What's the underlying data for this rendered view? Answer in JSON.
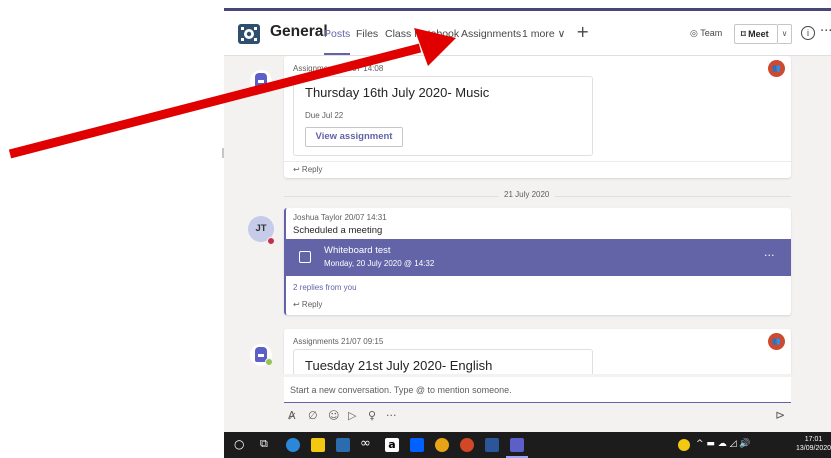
{
  "channel": {
    "name": "General",
    "icon": "team-icon"
  },
  "tabs": [
    {
      "label": "Posts",
      "active": true
    },
    {
      "label": "Files"
    },
    {
      "label": "Class Notebook"
    },
    {
      "label": "Assignments"
    },
    {
      "label": "1 more ∨"
    }
  ],
  "header": {
    "add_icon": "+",
    "team_label": "◎ Team",
    "meet_label": "Meet",
    "meet_icon": "video-camera-icon",
    "caret": "∨",
    "info": "i",
    "more": "···"
  },
  "messages": {
    "first": {
      "meta": "Assignments 20/07 14:08",
      "title": "Thursday 16th July 2020- Music",
      "due": "Due Jul 22",
      "button": "View assignment",
      "reply": "↩ Reply"
    },
    "date_divider": "21 July 2020",
    "second": {
      "avatar": "JT",
      "meta": "Joshua Taylor  20/07 14:31",
      "text": "Scheduled a meeting",
      "meeting_title": "Whiteboard test",
      "meeting_time": "Monday, 20 July 2020 @ 14:32",
      "meeting_more": "···",
      "replies": "2 replies from you",
      "reply": "↩ Reply"
    },
    "third": {
      "meta": "Assignments  21/07 09:15",
      "title": "Tuesday 21st July 2020- English"
    }
  },
  "compose": {
    "placeholder": "Start a new conversation. Type @ to mention someone.",
    "send": "⊳"
  },
  "taskbar": {
    "time": "17:01",
    "date": "13/09/2020",
    "tray": "^ ▬ ☁ ◿ 🔊"
  },
  "colors": {
    "accent": "#6264a7",
    "arrow": "#e00000",
    "reaction": "#cc4a31"
  }
}
